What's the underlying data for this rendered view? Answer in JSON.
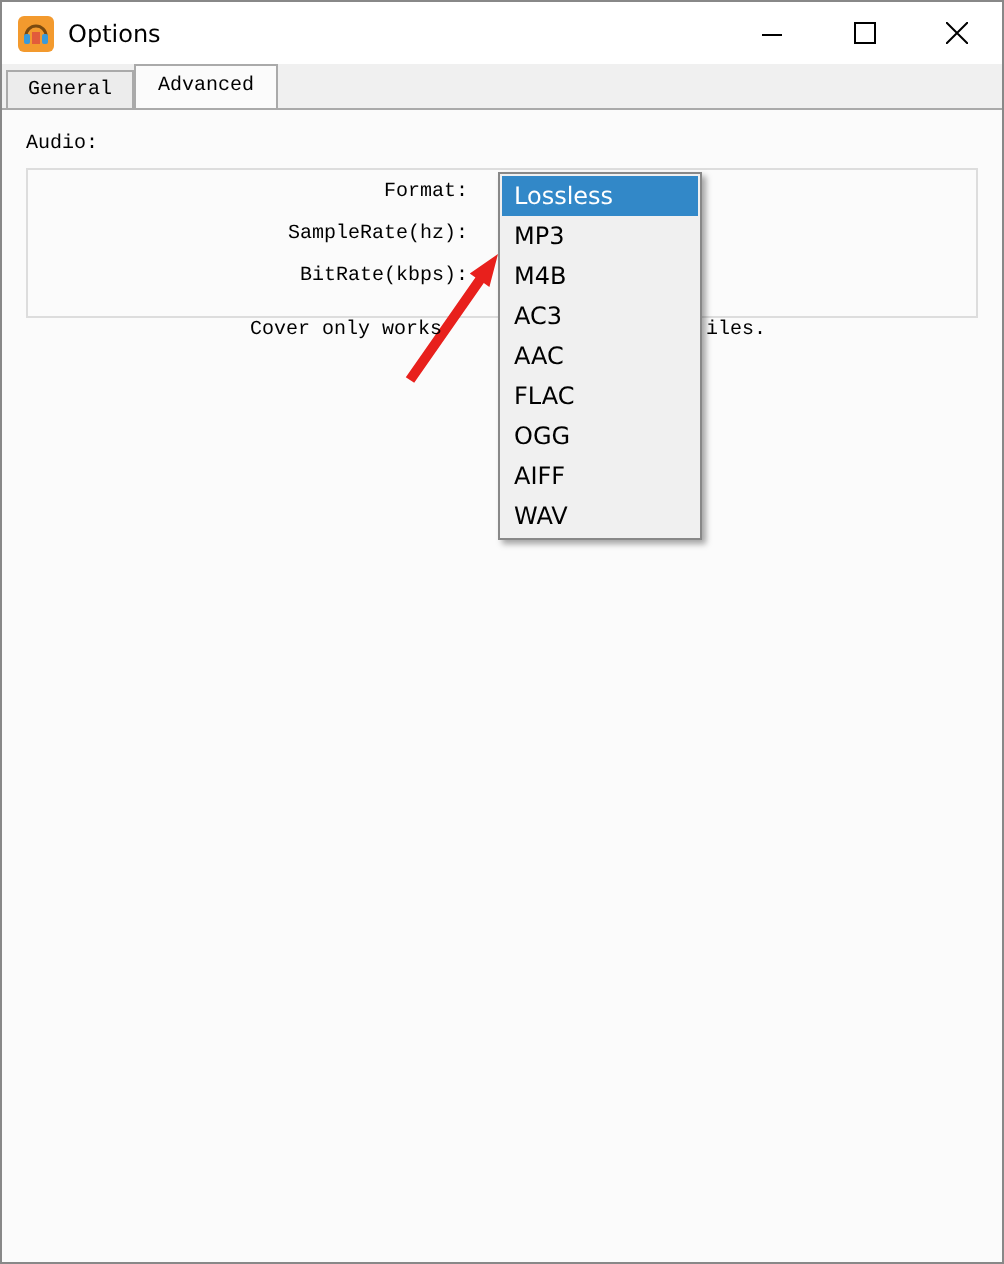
{
  "window": {
    "title": "Options"
  },
  "tabs": [
    {
      "label": "General",
      "selected": false
    },
    {
      "label": "Advanced",
      "selected": true
    }
  ],
  "section": "Audio:",
  "fields": [
    "Format:",
    "SampleRate(hz):",
    "BitRate(kbps):"
  ],
  "note": {
    "before": "Cover only works",
    "after": "iles."
  },
  "dropdown": {
    "options": [
      {
        "label": "Lossless",
        "selected": true
      },
      {
        "label": "MP3",
        "selected": false
      },
      {
        "label": "M4B",
        "selected": false
      },
      {
        "label": "AC3",
        "selected": false
      },
      {
        "label": "AAC",
        "selected": false
      },
      {
        "label": "FLAC",
        "selected": false
      },
      {
        "label": "OGG",
        "selected": false
      },
      {
        "label": "AIFF",
        "selected": false
      },
      {
        "label": "WAV",
        "selected": false
      }
    ]
  }
}
